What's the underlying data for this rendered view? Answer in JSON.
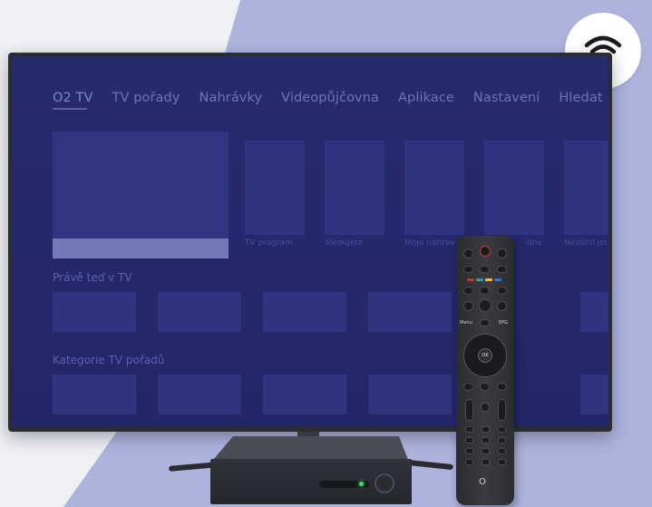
{
  "tv": {
    "nav": [
      {
        "label": "O2 TV",
        "active": true
      },
      {
        "label": "TV pořady",
        "active": false
      },
      {
        "label": "Nahrávky",
        "active": false
      },
      {
        "label": "Videopůjčovna",
        "active": false
      },
      {
        "label": "Aplikace",
        "active": false
      },
      {
        "label": "Nastavení",
        "active": false
      },
      {
        "label": "Hledat",
        "active": false
      }
    ],
    "tiles_row1": [
      {
        "label": "TV program"
      },
      {
        "label": "Sledujete"
      },
      {
        "label": "Moje nahráv"
      },
      {
        "label": "dne"
      },
      {
        "label": "Nestihli jst"
      }
    ],
    "section_now": "Právě teď v TV",
    "section_categories": "Kategorie TV pořadů"
  },
  "remote": {
    "ok_label": "OK",
    "epg_label": "EPG",
    "menu_label": "Menu",
    "logo": "O"
  },
  "icons": {
    "wifi": "wifi-icon"
  },
  "colors": {
    "screen_bg": "#24286b",
    "accent_purple": "#aeb3dd",
    "led_green": "#39e36b"
  }
}
